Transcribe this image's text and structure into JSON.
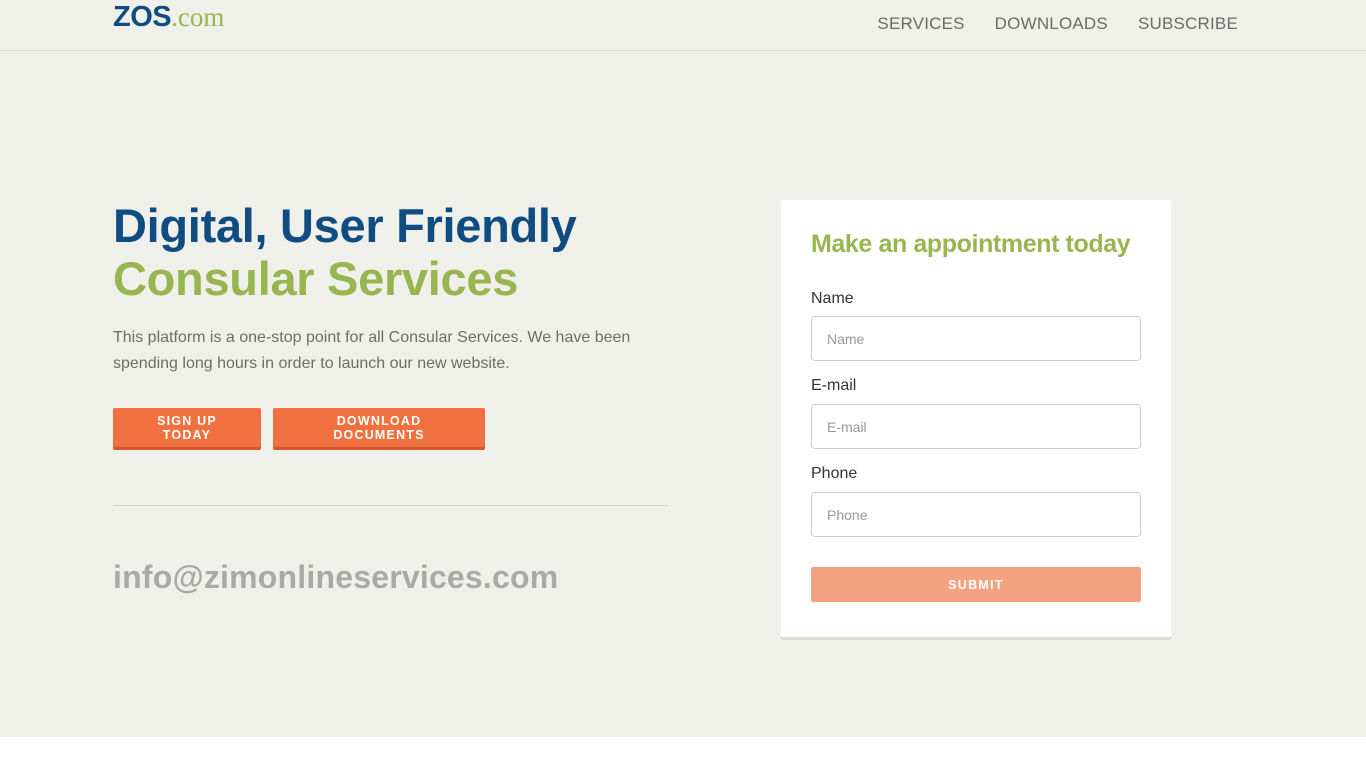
{
  "header": {
    "logo": {
      "primary": "ZOS",
      "secondary": ".com"
    },
    "nav": [
      {
        "label": "SERVICES"
      },
      {
        "label": "DOWNLOADS"
      },
      {
        "label": "SUBSCRIBE"
      }
    ]
  },
  "hero": {
    "headline_line1": "Digital, User Friendly",
    "headline_line2": "Consular Services",
    "lead": "This platform is a one-stop point for all Consular Services. We have been spending long hours in order to launch our new website.",
    "buttons": {
      "signup": "SIGN UP TODAY",
      "download": "DOWNLOAD DOCUMENTS"
    },
    "email": "info@zimonlineservices.com"
  },
  "appointment_form": {
    "title": "Make an appointment today",
    "fields": [
      {
        "label": "Name",
        "placeholder": "Name",
        "value": ""
      },
      {
        "label": "E-mail",
        "placeholder": "E-mail",
        "value": ""
      },
      {
        "label": "Phone",
        "placeholder": "Phone",
        "value": ""
      }
    ],
    "submit_label": "SUBMIT"
  },
  "colors": {
    "brand_blue": "#0f4c81",
    "brand_green": "#98b650",
    "accent_orange": "#f0703f",
    "submit_orange_light": "#f4a281",
    "page_background": "#f0f0eb"
  }
}
